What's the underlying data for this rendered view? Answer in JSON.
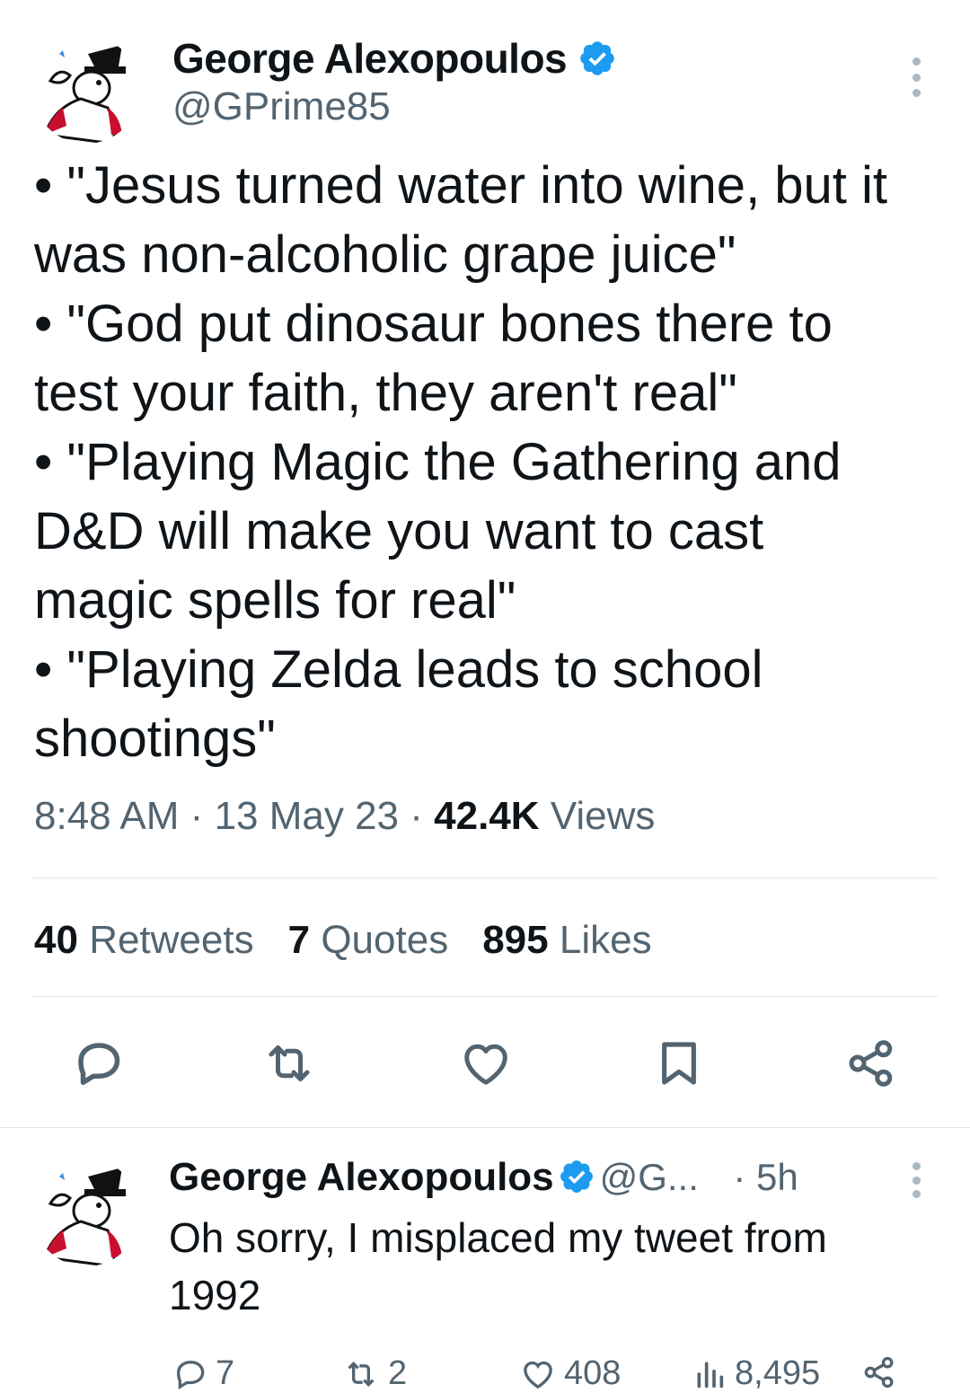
{
  "tweet": {
    "author_name": "George Alexopoulos",
    "author_handle": "@GPrime85",
    "lines": [
      "• \"Jesus turned water into wine, but it",
      "was non-alcoholic grape juice\"",
      "• \"God put dinosaur bones there to",
      "test your faith, they aren't real\"",
      "• \"Playing Magic the Gathering and",
      "D&D will make you want to cast",
      "magic spells for real\"",
      "• \"Playing Zelda leads to school",
      "shootings\""
    ],
    "time": "8:48 AM",
    "date": "13 May 23",
    "views_count": "42.4K",
    "views_label": "Views",
    "retweets_count": "40",
    "retweets_label": "Retweets",
    "quotes_count": "7",
    "quotes_label": "Quotes",
    "likes_count": "895",
    "likes_label": "Likes",
    "icons": [
      "reply-icon",
      "retweet-icon",
      "like-icon",
      "bookmark-icon",
      "share-icon"
    ]
  },
  "reply": {
    "author_name": "George Alexopoulos",
    "author_handle": "@G...",
    "age": "· 5h",
    "text_line1": "Oh sorry, I misplaced my tweet from",
    "text_line2": "1992",
    "reply_count": "7",
    "retweet_count": "2",
    "like_count": "408",
    "views_count": "8,495"
  },
  "colors": {
    "verified": "#1d9bf0",
    "muted": "#536471",
    "text": "#0f1419",
    "divider": "#dfe3e7"
  }
}
